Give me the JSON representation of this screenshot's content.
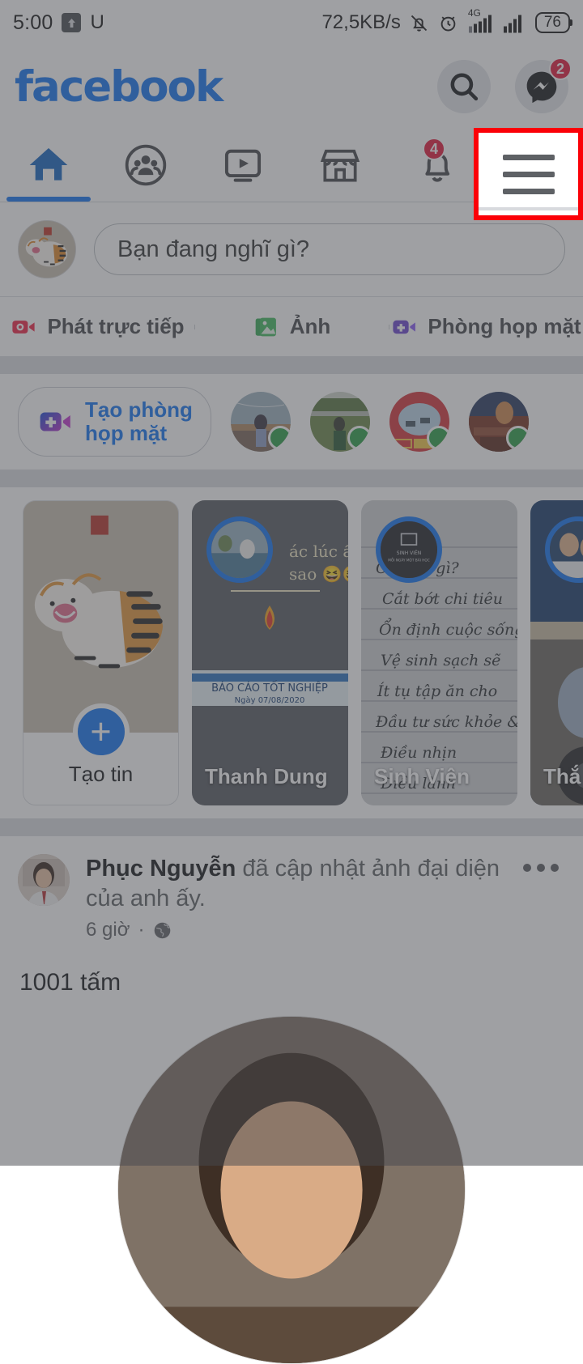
{
  "status_bar": {
    "time": "5:00",
    "upload_icon": "upload-arrow-icon",
    "carrier_glyph": "U",
    "network_speed": "72,5KB/s",
    "mute_icon": "bell-muted-icon",
    "alarm_icon": "alarm-clock-icon",
    "network_type": "4G",
    "signal_icon_1": "signal-bars-icon",
    "signal_icon_2": "signal-bars-icon",
    "battery_level": "76"
  },
  "header": {
    "logo_text": "facebook",
    "logo_color": "#1877f2",
    "search_icon": "search-icon",
    "messenger_icon": "messenger-icon",
    "messenger_badge": "2"
  },
  "tabs": [
    {
      "name": "home",
      "icon": "home-icon",
      "active": true,
      "badge": ""
    },
    {
      "name": "groups",
      "icon": "groups-icon",
      "active": false,
      "badge": ""
    },
    {
      "name": "watch",
      "icon": "video-play-icon",
      "active": false,
      "badge": ""
    },
    {
      "name": "marketplace",
      "icon": "marketplace-icon",
      "active": false,
      "badge": ""
    },
    {
      "name": "notifications",
      "icon": "bell-icon",
      "active": false,
      "badge": "4"
    },
    {
      "name": "menu",
      "icon": "hamburger-menu-icon",
      "active": false,
      "badge": ""
    }
  ],
  "composer": {
    "avatar": "tiger-profile-avatar",
    "placeholder": "Bạn đang nghĩ gì?"
  },
  "action_row": [
    {
      "label": "Phát trực tiếp",
      "icon": "live-video-icon",
      "color": "#f02849"
    },
    {
      "label": "Ảnh",
      "icon": "photo-icon",
      "color": "#45bd62"
    },
    {
      "label": "Phòng họp mặt",
      "icon": "room-video-icon",
      "color": "#6f4ad2"
    }
  ],
  "rooms": {
    "create_label_line1": "Tạo phòng",
    "create_label_line2": "họp mặt",
    "create_icon": "video-plus-icon",
    "avatars": [
      {
        "name": "room-avatar-1",
        "online": true
      },
      {
        "name": "room-avatar-2",
        "online": true
      },
      {
        "name": "room-avatar-3",
        "online": true
      },
      {
        "name": "room-avatar-4",
        "online": true
      }
    ]
  },
  "stories": [
    {
      "label": "Tạo tin",
      "type": "create"
    },
    {
      "label": "Thanh Dung",
      "type": "story"
    },
    {
      "label": "Sinh Viên",
      "type": "story"
    },
    {
      "label": "Thắ",
      "type": "story"
    }
  ],
  "story_overlay_texts": {
    "story2_line1": "ác lúc ấy",
    "story2_line2": "sao 😆😆",
    "story2_banner": "BÁO CÁO TỐT NGHIỆP",
    "story2_banner_date": "Ngày 07/08/2020",
    "story3_avatar_line1": "SINH VIÊN",
    "story3_avatar_line2": "MỖI NGÀY MỘT BÀI HỌC",
    "story3_lines": [
      "C 19 là gì?",
      "Cắt bớt chi tiêu",
      "Ổn định cuộc sống",
      "Vệ sinh sạch sẽ",
      "Ít tụ tập ăn cho",
      "Đầu tư sức khỏe &",
      "Điều nhịn",
      "Điều lành"
    ]
  },
  "post": {
    "author": "Phục Nguyễn",
    "action_text": " đã cập nhật ảnh đại diện của anh ấy.",
    "time": "6 giờ",
    "separator": "·",
    "privacy_icon": "globe-icon",
    "menu_icon": "more-options-icon",
    "body": "1001 tấm"
  },
  "highlight": {
    "target": "hamburger-menu-icon",
    "border_color": "#fb0007"
  }
}
